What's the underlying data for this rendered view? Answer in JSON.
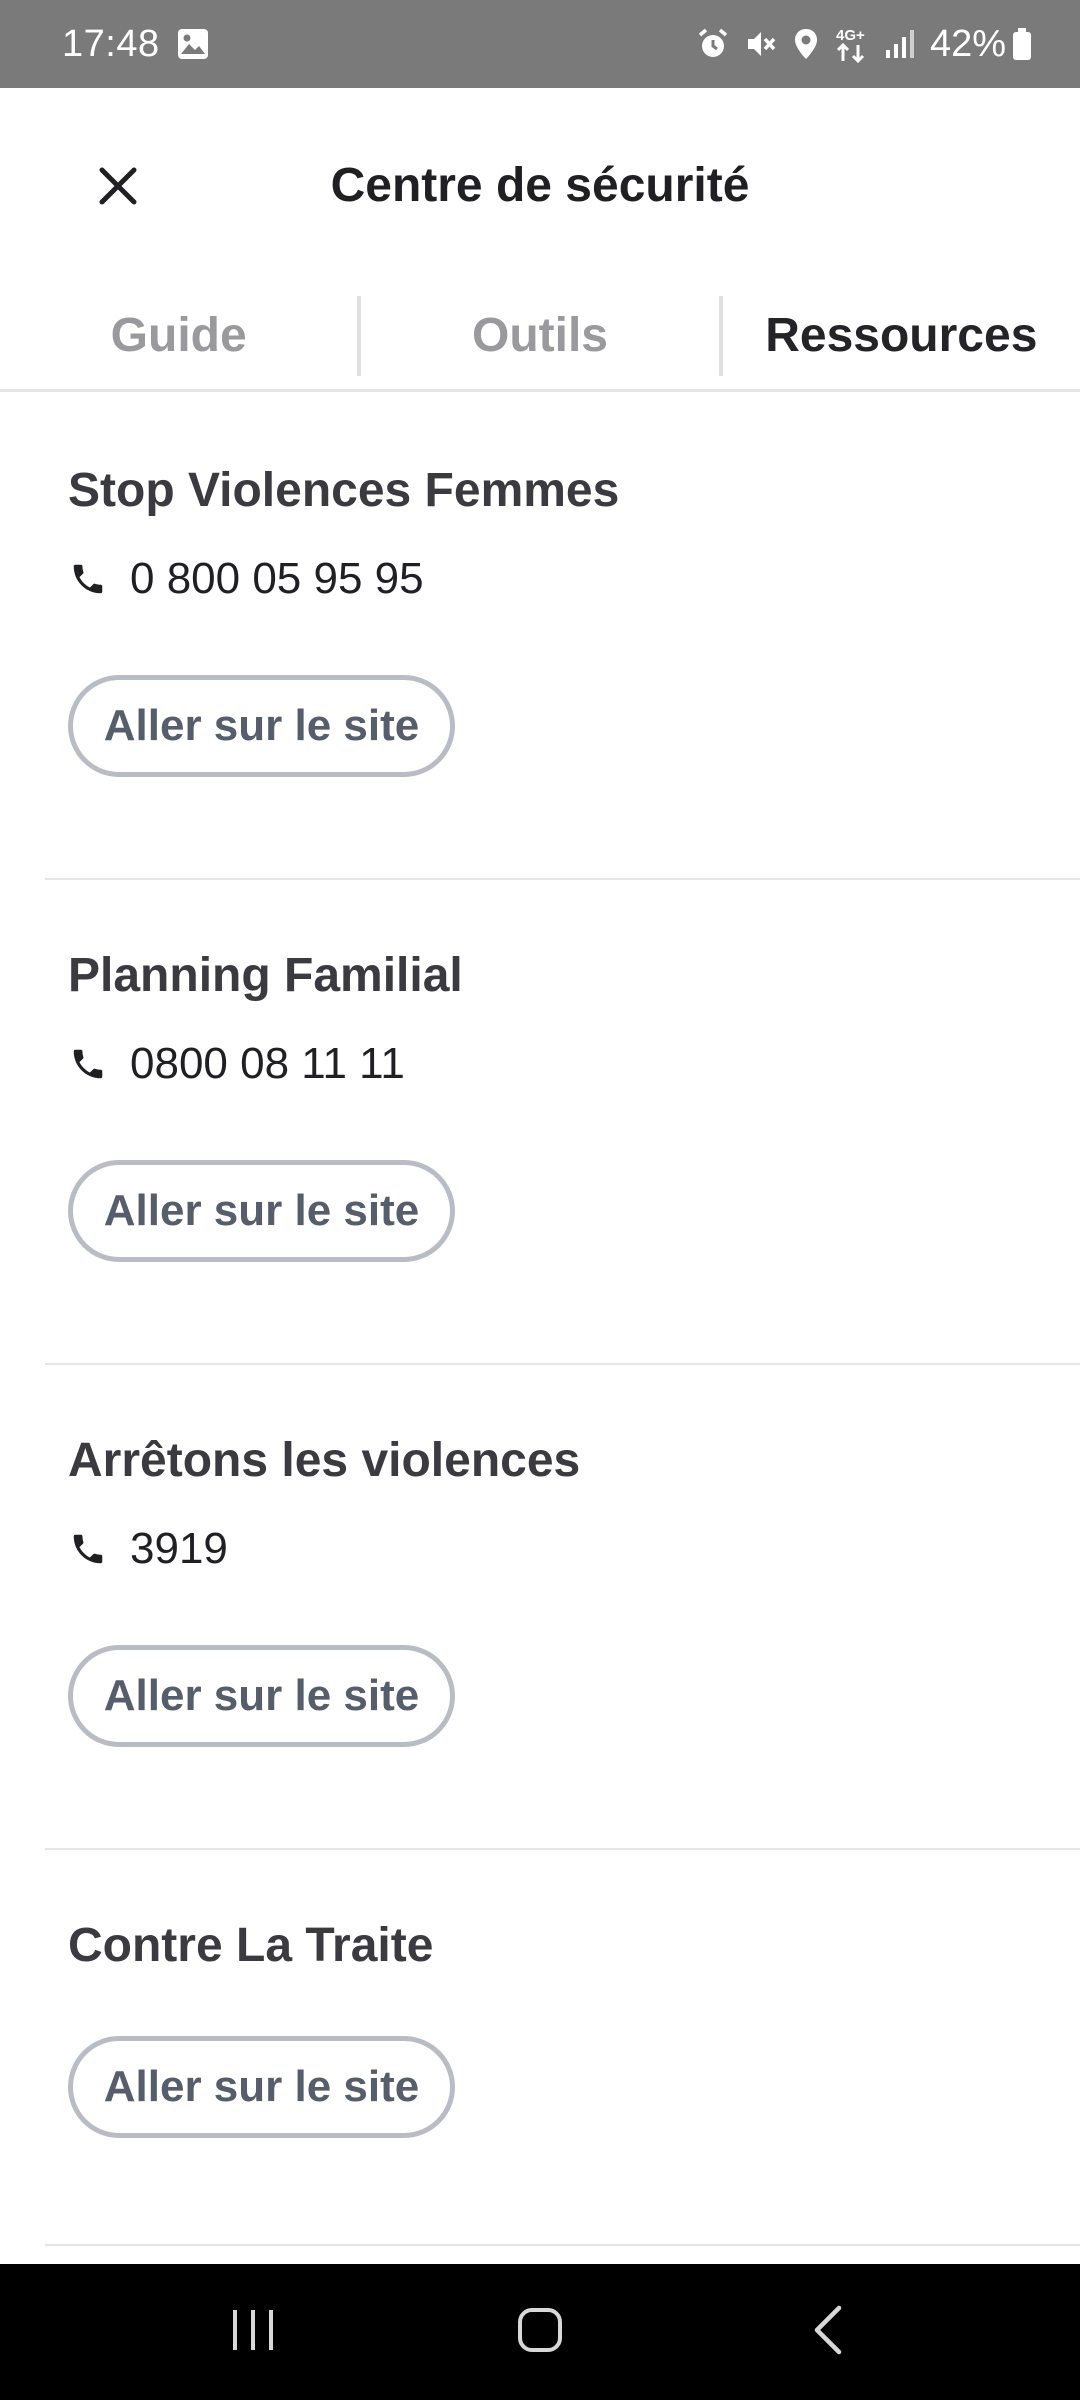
{
  "status_bar": {
    "time": "17:48",
    "battery_percent": "42%",
    "network": "4G+",
    "icons": [
      "gallery-icon",
      "alarm-icon",
      "mute-icon",
      "location-icon",
      "data-arrows-icon",
      "signal-icon",
      "battery-icon"
    ]
  },
  "header": {
    "title": "Centre de sécurité",
    "close_icon": "close-icon"
  },
  "tabs": [
    {
      "label": "Guide",
      "active": false
    },
    {
      "label": "Outils",
      "active": false
    },
    {
      "label": "Ressources",
      "active": true
    }
  ],
  "resources": [
    {
      "name": "Stop Violences Femmes",
      "phone": "0 800 05 95 95",
      "button_label": "Aller sur le site"
    },
    {
      "name": "Planning Familial",
      "phone": "0800 08 11 11",
      "button_label": "Aller sur le site"
    },
    {
      "name": "Arrêtons les violences",
      "phone": "3919",
      "button_label": "Aller sur le site"
    },
    {
      "name": "Contre La Traite",
      "phone": "",
      "button_label": "Aller sur le site"
    }
  ],
  "nav_bar": {
    "buttons": [
      "recent-apps-icon",
      "home-icon",
      "back-icon"
    ]
  },
  "colors": {
    "status_bar_bg": "#7a7a7a",
    "active_tab": "#232328",
    "inactive_tab": "#9a9a9e",
    "button_border": "#b8bcc4",
    "button_text": "#565d6b"
  }
}
